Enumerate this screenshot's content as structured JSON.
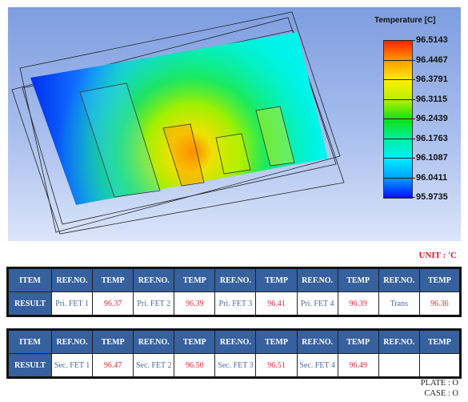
{
  "legend": {
    "title": "Temperature [C]",
    "ticks": [
      "96.5143",
      "96.4467",
      "96.3791",
      "96.3115",
      "96.2439",
      "96.1763",
      "96.1087",
      "96.0411",
      "95.9735"
    ],
    "colors": [
      "#ff2000",
      "#ff9a00",
      "#ffee00",
      "#b8f000",
      "#10e010",
      "#00f0a0",
      "#00eeff",
      "#00a0ff",
      "#0010ff"
    ]
  },
  "unit": "UNIT : 'C",
  "tables": [
    {
      "header": [
        "ITEM",
        "REF.NO.",
        "TEMP",
        "REF.NO.",
        "TEMP",
        "REF.NO.",
        "TEMP",
        "REF.NO.",
        "TEMP",
        "REF.NO.",
        "TEMP"
      ],
      "row": [
        "RESULT",
        "Pri. FET 1",
        "96.37",
        "Pri. FET 2",
        "96.39",
        "Pri. FET 3",
        "96.41",
        "Pri. FET 4",
        "96.39",
        "Trans",
        "96.36"
      ]
    },
    {
      "header": [
        "ITEM",
        "REF.NO.",
        "TEMP",
        "REF.NO.",
        "TEMP",
        "REF.NO.",
        "TEMP",
        "REF.NO.",
        "TEMP",
        "REF.NO.",
        "TEMP"
      ],
      "row": [
        "RESULT",
        "Sec. FET 1",
        "96.47",
        "Sec. FET 2",
        "96.50",
        "Sec. FET 3",
        "96.51",
        "Sec. FET 4",
        "96.49",
        "",
        ""
      ]
    }
  ],
  "footer": {
    "plate": "PLATE : O",
    "case": "CASE : O"
  }
}
